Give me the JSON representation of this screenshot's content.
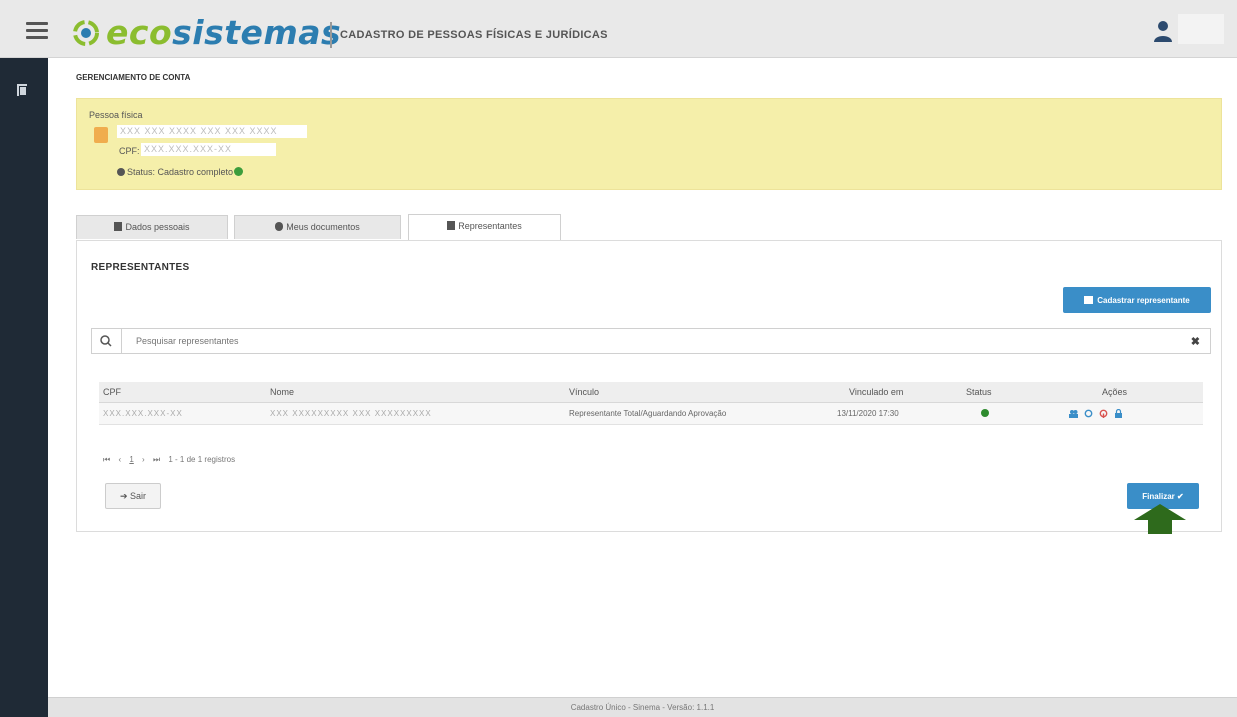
{
  "header": {
    "brand_eco": "eco",
    "brand_sistemas": "sistemas",
    "app_title": "CADASTRO DE PESSOAS FÍSICAS E JURÍDICAS",
    "menu_icon": "hamburger-icon",
    "user_icon": "user-icon"
  },
  "sidebar": {
    "items": [
      {
        "icon": "book-icon"
      }
    ]
  },
  "page": {
    "heading": "GERENCIAMENTO DE CONTA"
  },
  "person": {
    "type_label": "Pessoa física",
    "name_masked": "XXX XXX XXXX XXX XXX XXXX",
    "cpf_label": "CPF:",
    "cpf_masked": "XXX.XXX.XXX-XX",
    "status_text": "Status: Cadastro completo"
  },
  "tabs": [
    {
      "label": "Dados pessoais",
      "icon": "file-icon",
      "active": false
    },
    {
      "label": "Meus documentos",
      "icon": "cloud-icon",
      "active": false
    },
    {
      "label": "Representantes",
      "icon": "users-icon",
      "active": true
    }
  ],
  "representantes": {
    "title": "REPRESENTANTES",
    "add_button": "Cadastrar representante",
    "search_placeholder": "Pesquisar representantes",
    "columns": [
      "CPF",
      "Nome",
      "Vínculo",
      "Vinculado em",
      "Status",
      "Ações"
    ],
    "rows": [
      {
        "cpf": "XXX.XXX.XXX-XX",
        "nome": "XXX XXXXXXXXX XXX XXXXXXXXX",
        "vinculo": "Representante Total/Aguardando Aprovação",
        "vinculado_em": "13/11/2020 17:30",
        "status": "active",
        "actions": [
          "users-icon",
          "refresh-icon",
          "unlink-icon",
          "lock-icon"
        ]
      }
    ],
    "pagination": {
      "first": "⏮",
      "prev": "‹",
      "page": "1",
      "next": "›",
      "last": "⏭",
      "summary": "1 - 1 de 1 registros"
    },
    "exit_button": "Sair",
    "finish_button": "Finalizar ✔"
  },
  "footer": {
    "text": "Cadastro Único - Sinema - Versão: 1.1.1"
  },
  "colors": {
    "primary": "#3a8ec8",
    "panel_yellow": "#f5efaa",
    "sidebar": "#1f2a36",
    "success": "#2e8b2e",
    "arrow": "#2e6a1c"
  }
}
